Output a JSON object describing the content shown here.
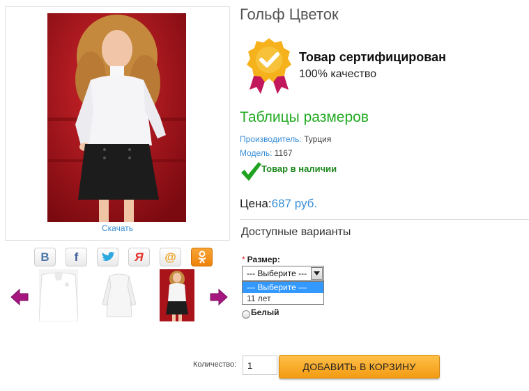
{
  "product": {
    "title": "Гольф Цветок",
    "download_label": "Скачать",
    "certified_title": "Товар сертифицирован",
    "certified_sub": "100% качество",
    "size_table_link": "Таблицы размеров",
    "manufacturer_key": "Производитель:",
    "manufacturer_value": "Турция",
    "model_key": "Модель:",
    "model_value": "1167",
    "stock_status": "Товар в наличии",
    "price_label": "Цена:",
    "price_value": "687 руб."
  },
  "share": [
    "vk-icon",
    "facebook-icon",
    "twitter-icon",
    "odnoklassniki-alt-icon",
    "mail-ru-icon",
    "ok-icon"
  ],
  "options": {
    "heading": "Доступные варианты",
    "size": {
      "required_mark": "*",
      "label": "Размер:",
      "selected": "--- Выберите ---",
      "items": [
        "--- Выберите ---",
        "11 лет"
      ]
    },
    "color": {
      "label": "Белый"
    }
  },
  "purchase": {
    "qty_label": "Количество:",
    "qty_value": "1",
    "add_to_cart": "ДОБАВИТЬ В КОРЗИНУ"
  },
  "colors": {
    "link_blue": "#3a8fd6",
    "green": "#22aa22",
    "cart_orange": "#f5a623",
    "background_red": "#9d0f16"
  }
}
